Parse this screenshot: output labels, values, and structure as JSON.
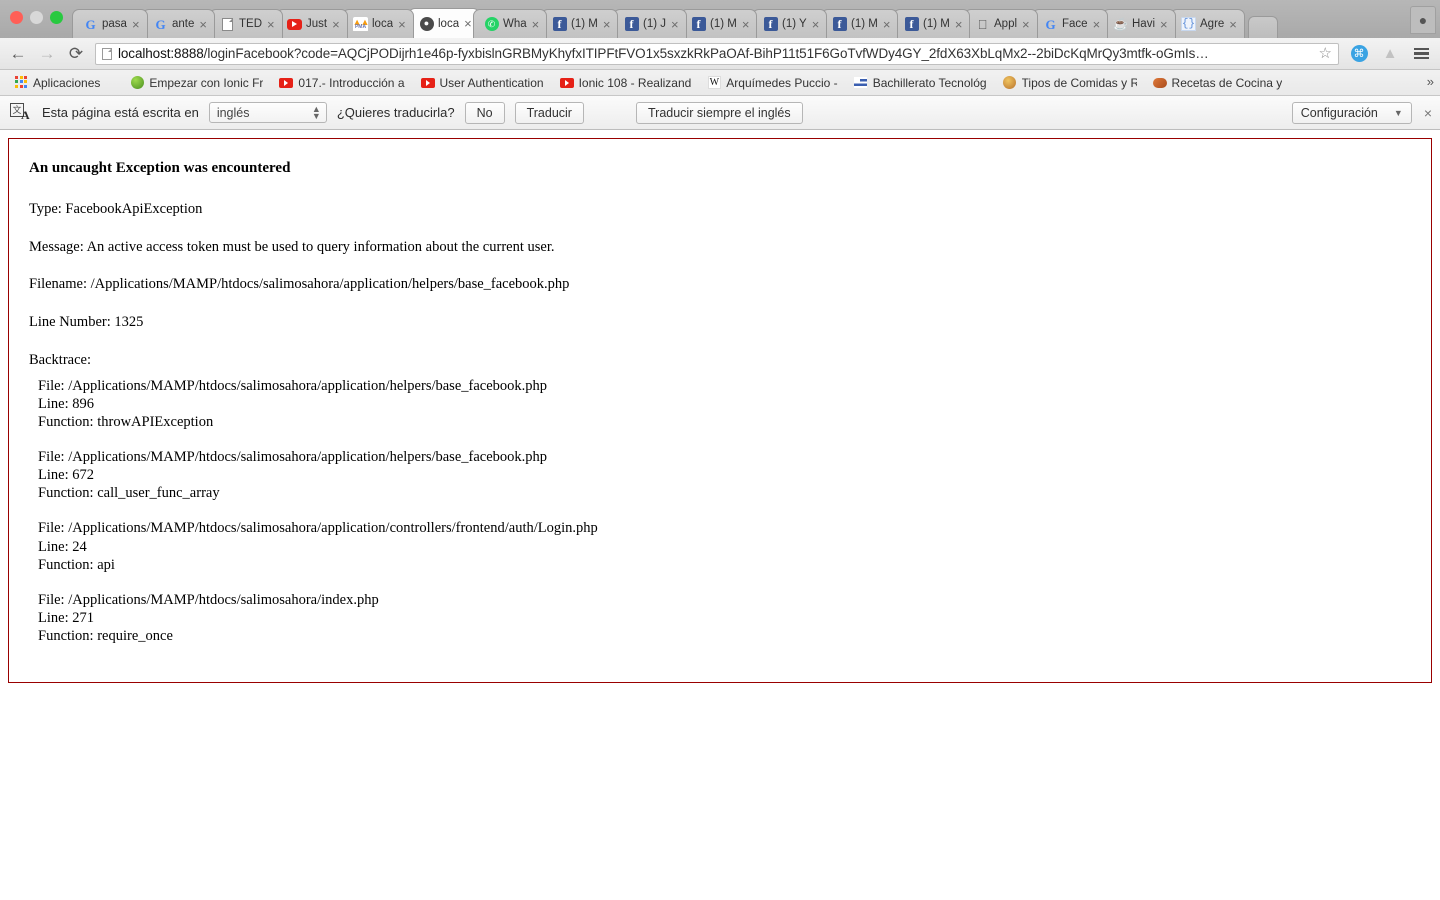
{
  "window": {
    "controls": [
      "close",
      "minimize",
      "maximize"
    ]
  },
  "tabs": [
    {
      "label": "pasa",
      "icon": "google-icon",
      "active": false
    },
    {
      "label": "ante",
      "icon": "google-icon",
      "active": false
    },
    {
      "label": "TED",
      "icon": "document-icon",
      "active": false
    },
    {
      "label": "Just",
      "icon": "youtube-icon",
      "active": false
    },
    {
      "label": "loca",
      "icon": "phpmyadmin-icon",
      "active": false
    },
    {
      "label": "loca",
      "icon": "codeigniter-icon",
      "active": true
    },
    {
      "label": "Wha",
      "icon": "whatsapp-icon",
      "active": false
    },
    {
      "label": "(1) M",
      "icon": "facebook-icon",
      "active": false
    },
    {
      "label": "(1) J",
      "icon": "facebook-icon",
      "active": false
    },
    {
      "label": "(1) M",
      "icon": "facebook-icon",
      "active": false
    },
    {
      "label": "(1) Y",
      "icon": "facebook-icon",
      "active": false
    },
    {
      "label": "(1) M",
      "icon": "facebook-icon",
      "active": false
    },
    {
      "label": "(1) M",
      "icon": "facebook-icon",
      "active": false
    },
    {
      "label": "Appl",
      "icon": "apple-icon",
      "active": false
    },
    {
      "label": "Face",
      "icon": "google-icon",
      "active": false
    },
    {
      "label": "Havi",
      "icon": "java-icon",
      "active": false
    },
    {
      "label": "Agre",
      "icon": "code-icon",
      "active": false
    }
  ],
  "toolbar": {
    "back": "←",
    "forward": "→",
    "reload": "⟳",
    "url_host": "localhost:8888",
    "url_rest": "/loginFacebook?code=AQCjPODijrh1e46p-fyxbislnGRBMyKhyfxITIPFtFVO1x5sxzkRkPaOAf-BihP11t51F6GoTvfWDy4GY_2fdX63XbLqMx2--2biDcKqMrQy3mtfk-oGmIs…",
    "star": "☆",
    "cmd_icon_label": "⌘",
    "drive_icon_label": "▲",
    "menu_label": "menu"
  },
  "bookmarks": {
    "items": [
      {
        "label": "Aplicaciones",
        "icon": "apps-grid-icon"
      },
      {
        "label": "Empezar con Ionic Fr",
        "icon": "ionic-icon"
      },
      {
        "label": "017.- Introducción a",
        "icon": "youtube-icon"
      },
      {
        "label": "User Authentication",
        "icon": "youtube-icon"
      },
      {
        "label": "Ionic 108 - Realizand",
        "icon": "youtube-icon"
      },
      {
        "label": "Arquímedes Puccio -",
        "icon": "wikipedia-icon"
      },
      {
        "label": "Bachillerato Tecnológ",
        "icon": "flag-icon"
      },
      {
        "label": "Tipos de Comidas y R",
        "icon": "food-icon"
      },
      {
        "label": "Recetas de Cocina y",
        "icon": "recipe-icon"
      }
    ],
    "overflow": "»"
  },
  "translate_bar": {
    "message": "Esta página está escrita en",
    "language": "inglés",
    "question": "¿Quieres traducirla?",
    "no_label": "No",
    "translate_label": "Traducir",
    "always_label": "Traducir siempre el inglés",
    "settings_label": "Configuración",
    "close_label": "×"
  },
  "error_page": {
    "title": "An uncaught Exception was encountered",
    "type_line": "Type: FacebookApiException",
    "message_line": "Message: An active access token must be used to query information about the current user.",
    "filename_line": "Filename: /Applications/MAMP/htdocs/salimosahora/application/helpers/base_facebook.php",
    "line_number_line": "Line Number: 1325",
    "backtrace_label": "Backtrace:",
    "border_color": "#990000",
    "frames": [
      {
        "file": "File: /Applications/MAMP/htdocs/salimosahora/application/helpers/base_facebook.php",
        "line": "Line: 896",
        "function": "Function: throwAPIException"
      },
      {
        "file": "File: /Applications/MAMP/htdocs/salimosahora/application/helpers/base_facebook.php",
        "line": "Line: 672",
        "function": "Function: call_user_func_array"
      },
      {
        "file": "File: /Applications/MAMP/htdocs/salimosahora/application/controllers/frontend/auth/Login.php",
        "line": "Line: 24",
        "function": "Function: api"
      },
      {
        "file": "File: /Applications/MAMP/htdocs/salimosahora/index.php",
        "line": "Line: 271",
        "function": "Function: require_once"
      }
    ]
  }
}
